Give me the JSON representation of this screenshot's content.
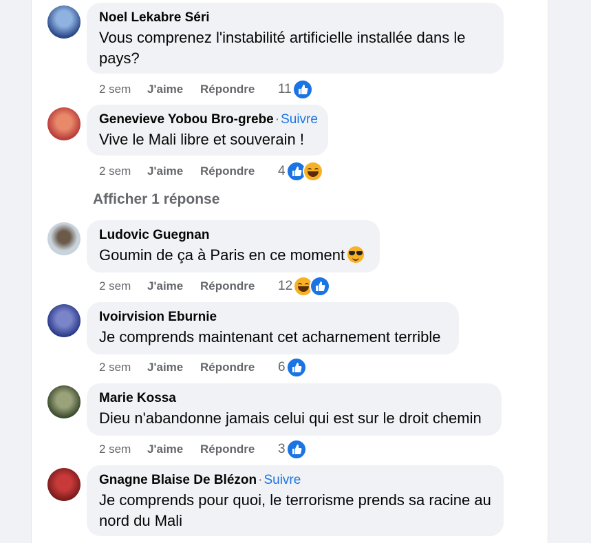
{
  "comments": [
    {
      "name": "Noel Lekabre Séri",
      "follow": "",
      "text": "Vous comprenez l'instabilité artificielle installée dans le pays?",
      "time": "2 sem",
      "like_label": "J'aime",
      "reply_label": "Répondre",
      "reaction_count": "11",
      "reactions": [
        "like-icon"
      ],
      "avatar_colors": [
        "#2d4a8a",
        "#8fb2e0"
      ]
    },
    {
      "name": "Genevieve Yobou Bro-grebe",
      "follow": "Suivre",
      "text": "Vive le Mali libre et souverain !",
      "time": "2 sem",
      "like_label": "J'aime",
      "reply_label": "Répondre",
      "reaction_count": "4",
      "reactions": [
        "like-icon",
        "haha-icon"
      ],
      "avatar_colors": [
        "#b83a3a",
        "#e88a6a"
      ]
    },
    {
      "name": "Ludovic Guegnan",
      "follow": "",
      "text": "Goumin de ça à Paris en ce moment",
      "time": "2 sem",
      "like_label": "J'aime",
      "reply_label": "Répondre",
      "reaction_count": "12",
      "reactions": [
        "haha-icon",
        "like-icon"
      ],
      "avatar_colors": [
        "#c9d3dc",
        "#6b5a4a"
      ]
    },
    {
      "name": "Ivoirvision Eburnie",
      "follow": "",
      "text": "Je comprends maintenant cet acharnement terrible",
      "time": "2 sem",
      "like_label": "J'aime",
      "reply_label": "Répondre",
      "reaction_count": "6",
      "reactions": [
        "like-icon"
      ],
      "avatar_colors": [
        "#2b3a8a",
        "#7a84c8"
      ]
    },
    {
      "name": "Marie Kossa",
      "follow": "",
      "text": "Dieu n'abandonne jamais celui qui est sur le droit chemin",
      "time": "2 sem",
      "like_label": "J'aime",
      "reply_label": "Répondre",
      "reaction_count": "3",
      "reactions": [
        "like-icon"
      ],
      "avatar_colors": [
        "#3c4a2e",
        "#9aa27a"
      ]
    },
    {
      "name": "Gnagne Blaise De Blézon",
      "follow": "Suivre",
      "text": "Je comprends pour quoi, le terrorisme prends sa racine au nord du Mali",
      "time": "",
      "like_label": "",
      "reply_label": "",
      "reaction_count": "",
      "reactions": [],
      "avatar_colors": [
        "#7a1c1c",
        "#c83a3a"
      ]
    }
  ],
  "show_replies_label": "Afficher 1 réponse",
  "colors": {
    "like_blue": "#1b74e4",
    "follow_blue": "#1b74e4",
    "bubble_bg": "#f0f2f5",
    "muted_text": "#65676b"
  }
}
